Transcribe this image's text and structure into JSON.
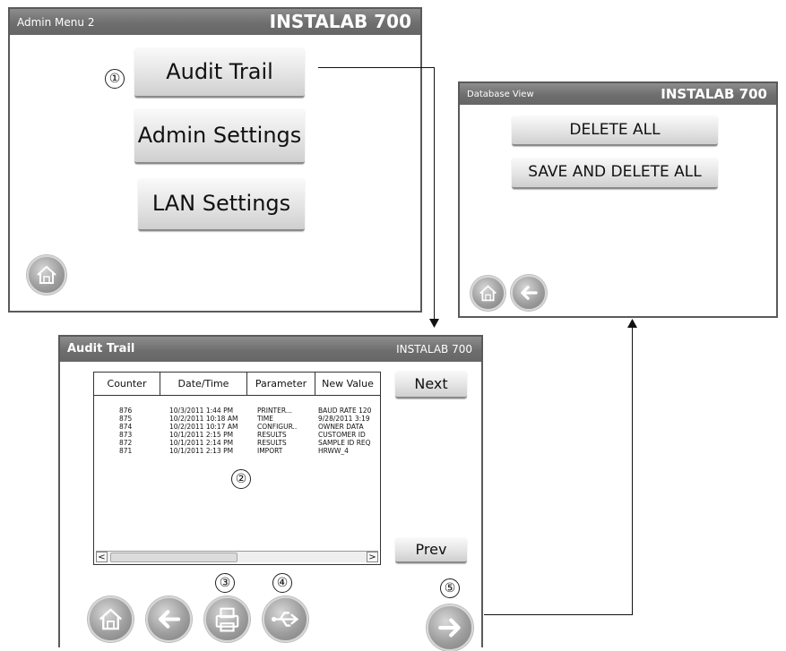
{
  "admin_menu": {
    "title": "Admin Menu 2",
    "brand": "INSTALAB 700",
    "buttons": [
      "Audit Trail",
      "Admin Settings",
      "LAN Settings"
    ],
    "marker": "①"
  },
  "database_view": {
    "title": "Database View",
    "brand": "INSTALAB 700",
    "buttons": [
      "DELETE ALL",
      "SAVE AND DELETE ALL"
    ]
  },
  "audit_trail": {
    "title": "Audit Trail",
    "brand": "INSTALAB 700",
    "columns": [
      "Counter",
      "Date/Time",
      "Parameter",
      "New Value"
    ],
    "rows": [
      [
        "876",
        "10/3/2011 1:44 PM",
        "PRINTER...",
        "BAUD RATE 120"
      ],
      [
        "875",
        "10/2/2011 10:18 AM",
        "TIME",
        "9/28/2011 3:19"
      ],
      [
        "874",
        "10/2/2011 10:17 AM",
        "CONFIGUR..",
        "OWNER DATA"
      ],
      [
        "873",
        "10/1/2011 2:15 PM",
        "RESULTS",
        "CUSTOMER ID"
      ],
      [
        "872",
        "10/1/2011 2:14 PM",
        "RESULTS",
        "SAMPLE ID REQ"
      ],
      [
        "871",
        "10/1/2011 2:13 PM",
        "IMPORT",
        "HRWW_4"
      ]
    ],
    "next_label": "Next",
    "prev_label": "Prev",
    "scroll_left": "<",
    "scroll_right": ">",
    "markers": [
      "②",
      "③",
      "④",
      "⑤"
    ]
  },
  "icons": [
    "home-icon",
    "back-icon",
    "printer-icon",
    "usb-icon",
    "forward-icon"
  ]
}
